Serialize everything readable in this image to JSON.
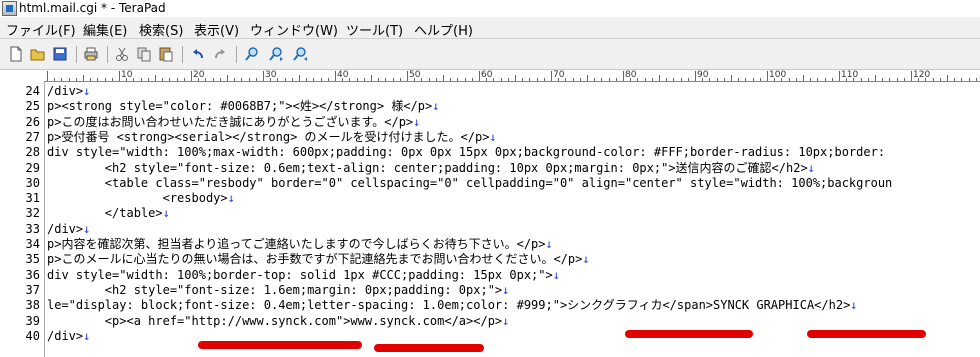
{
  "window": {
    "title": "html.mail.cgi * - TeraPad"
  },
  "menu": [
    "ファイル(F)",
    "編集(E)",
    "検索(S)",
    "表示(V)",
    "ウィンドウ(W)",
    "ツール(T)",
    "ヘルプ(H)"
  ],
  "toolbar": {
    "icons": [
      "new-icon",
      "open-icon",
      "save-icon",
      "print-icon",
      "cut-icon",
      "copy-icon",
      "paste-icon",
      "undo-icon",
      "redo-icon",
      "find-icon",
      "find-next-icon",
      "find-prev-icon"
    ]
  },
  "ruler": {
    "labels": [
      "10",
      "20",
      "30",
      "40",
      "50",
      "60",
      "70",
      "80",
      "90",
      "100",
      "110",
      "120"
    ]
  },
  "editor": {
    "newline_mark": "↓",
    "lines": [
      {
        "n": "24",
        "text": "/div>"
      },
      {
        "n": "25",
        "text": "p><strong style=\"color: #0068B7;\"><姓></strong> 様</p>"
      },
      {
        "n": "26",
        "text": "p>この度はお問い合わせいただき誠にありがとうございます。</p>"
      },
      {
        "n": "27",
        "text": "p>受付番号 <strong><serial></strong> のメールを受け付けました。</p>"
      },
      {
        "n": "28",
        "text": "div style=\"width: 100%;max-width: 600px;padding: 0px 0px 15px 0px;background-color: #FFF;border-radius: 10px;border:"
      },
      {
        "n": "29",
        "text": "        <h2 style=\"font-size: 0.6em;text-align: center;padding: 10px 0px;margin: 0px;\">送信内容のご確認</h2>"
      },
      {
        "n": "30",
        "text": "        <table class=\"resbody\" border=\"0\" cellspacing=\"0\" cellpadding=\"0\" align=\"center\" style=\"width: 100%;backgroun"
      },
      {
        "n": "31",
        "text": "                <resbody>"
      },
      {
        "n": "32",
        "text": "        </table>"
      },
      {
        "n": "33",
        "text": "/div>"
      },
      {
        "n": "34",
        "text": "p>内容を確認次第、担当者より追ってご連絡いたしますので今しばらくお待ち下さい。</p>"
      },
      {
        "n": "35",
        "text": "p>このメールに心当たりの無い場合は、お手数ですが下記連絡先までお問い合わせください。</p>"
      },
      {
        "n": "36",
        "text": "div style=\"width: 100%;border-top: solid 1px #CCC;padding: 15px 0px;\">"
      },
      {
        "n": "37",
        "text": "        <h2 style=\"font-size: 1.6em;margin: 0px;padding: 0px;\">"
      },
      {
        "n": "38",
        "text": "le=\"display: block;font-size: 0.4em;letter-spacing: 1.0em;color: #999;\">シンクグラフィカ</span>SYNCK GRAPHICA</h2>"
      },
      {
        "n": "39",
        "text": "        <p><a href=\"http://www.synck.com\">www.synck.com</a></p>"
      },
      {
        "n": "40",
        "text": "/div>"
      }
    ]
  },
  "colors": {
    "highlight": "#e00000",
    "newline": "#1e3ce6"
  }
}
